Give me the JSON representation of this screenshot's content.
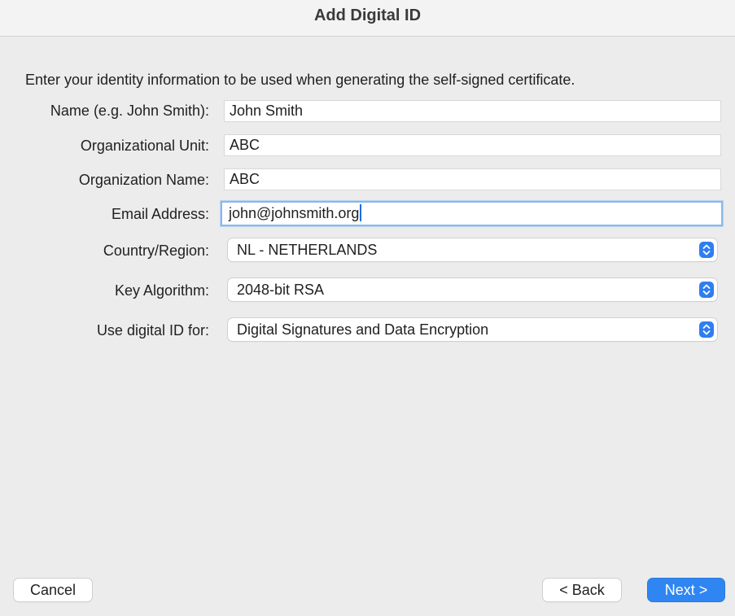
{
  "window": {
    "title": "Add Digital ID"
  },
  "form": {
    "intro": "Enter your identity information to be used when generating the self-signed certificate.",
    "fields": [
      {
        "label": "Name (e.g. John Smith):",
        "value": "John Smith"
      },
      {
        "label": "Organizational Unit:",
        "value": "ABC"
      },
      {
        "label": "Organization Name:",
        "value": "ABC"
      },
      {
        "label": "Email Address:",
        "value": "john@johnsmith.org"
      }
    ],
    "selects": [
      {
        "label": "Country/Region:",
        "value": "NL - NETHERLANDS",
        "icon": "updown-chevron-icon"
      },
      {
        "label": "Key Algorithm:",
        "value": "2048-bit RSA",
        "icon": "updown-chevron-icon"
      },
      {
        "label": "Use digital ID for:",
        "value": "Digital Signatures and Data Encryption",
        "icon": "updown-chevron-icon"
      }
    ]
  },
  "buttons": {
    "cancel": "Cancel",
    "back": "< Back",
    "next": "Next >"
  },
  "colors": {
    "accent": "#2f86f2",
    "focus_ring": "#8ab7ec",
    "background": "#ececec"
  }
}
